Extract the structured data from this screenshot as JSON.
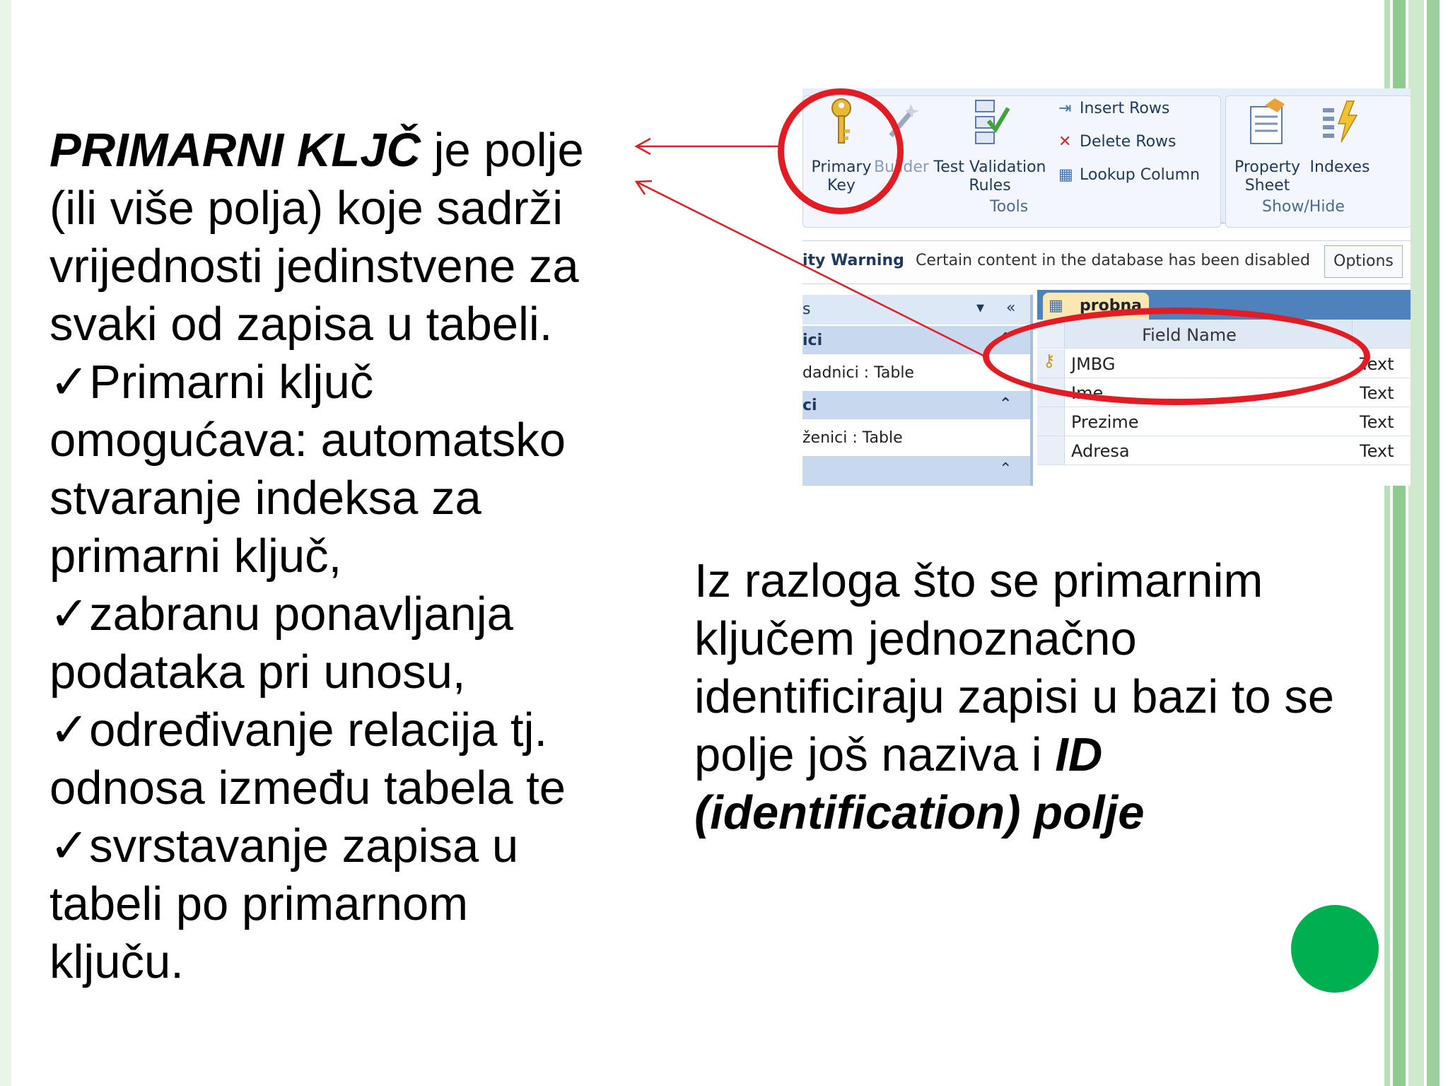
{
  "slide": {
    "left": {
      "title_bold": "PRIMARNI KLJČ",
      "title_rest": " je polje",
      "lines": [
        "(ili više polja) koje sadrži",
        "vrijednosti jedinstvene za",
        "svaki od zapisa u tabeli.",
        "✓Primarni ključ",
        "omogućava: automatsko",
        "stvaranje indeksa za",
        "primarni ključ,",
        "✓zabranu ponavljanja",
        "podataka pri unosu,",
        "✓određivanje relacija tj.",
        "odnosa između tabela te",
        "✓svrstavanje zapisa u",
        "tabeli po primarnom",
        "ključu."
      ]
    },
    "right": {
      "lines": [
        "Iz razloga što se primarnim",
        "ključem jednoznačno",
        "identificiraju zapisi u bazi to se"
      ],
      "last_prefix": "polje još naziva i ",
      "last_bold_1": "ID",
      "last_bold_2": "(identification) polje"
    },
    "colors": {
      "accent_green": "#00b050",
      "bar_green": "#a9d5a9",
      "arrow_red": "#e31b23"
    }
  },
  "screenshot": {
    "ribbon": {
      "primary_key": [
        "Primary",
        "Key"
      ],
      "builder": "Builder",
      "test_validation": [
        "Test Validation",
        "Rules"
      ],
      "insert_rows": "Insert Rows",
      "delete_rows": "Delete Rows",
      "lookup_column": "Lookup Column",
      "tools_label": "Tools",
      "property_sheet": [
        "Property",
        "Sheet"
      ],
      "indexes": "Indexes",
      "show_hide_label": "Show/Hide"
    },
    "warning": {
      "label": "ity Warning",
      "message": "Certain content in the database has been disabled",
      "options": "Options"
    },
    "nav": {
      "header": "s",
      "group1": "ici",
      "item1": "dadnici : Table",
      "group2": "ci",
      "item2": "ženici : Table"
    },
    "table": {
      "tab_name": "probna",
      "column_header": "Field Name",
      "rows": [
        {
          "field": "JMBG",
          "type": "Text"
        },
        {
          "field": "Ime",
          "type": "Text"
        },
        {
          "field": "Prezime",
          "type": "Text"
        },
        {
          "field": "Adresa",
          "type": "Text"
        }
      ]
    }
  }
}
